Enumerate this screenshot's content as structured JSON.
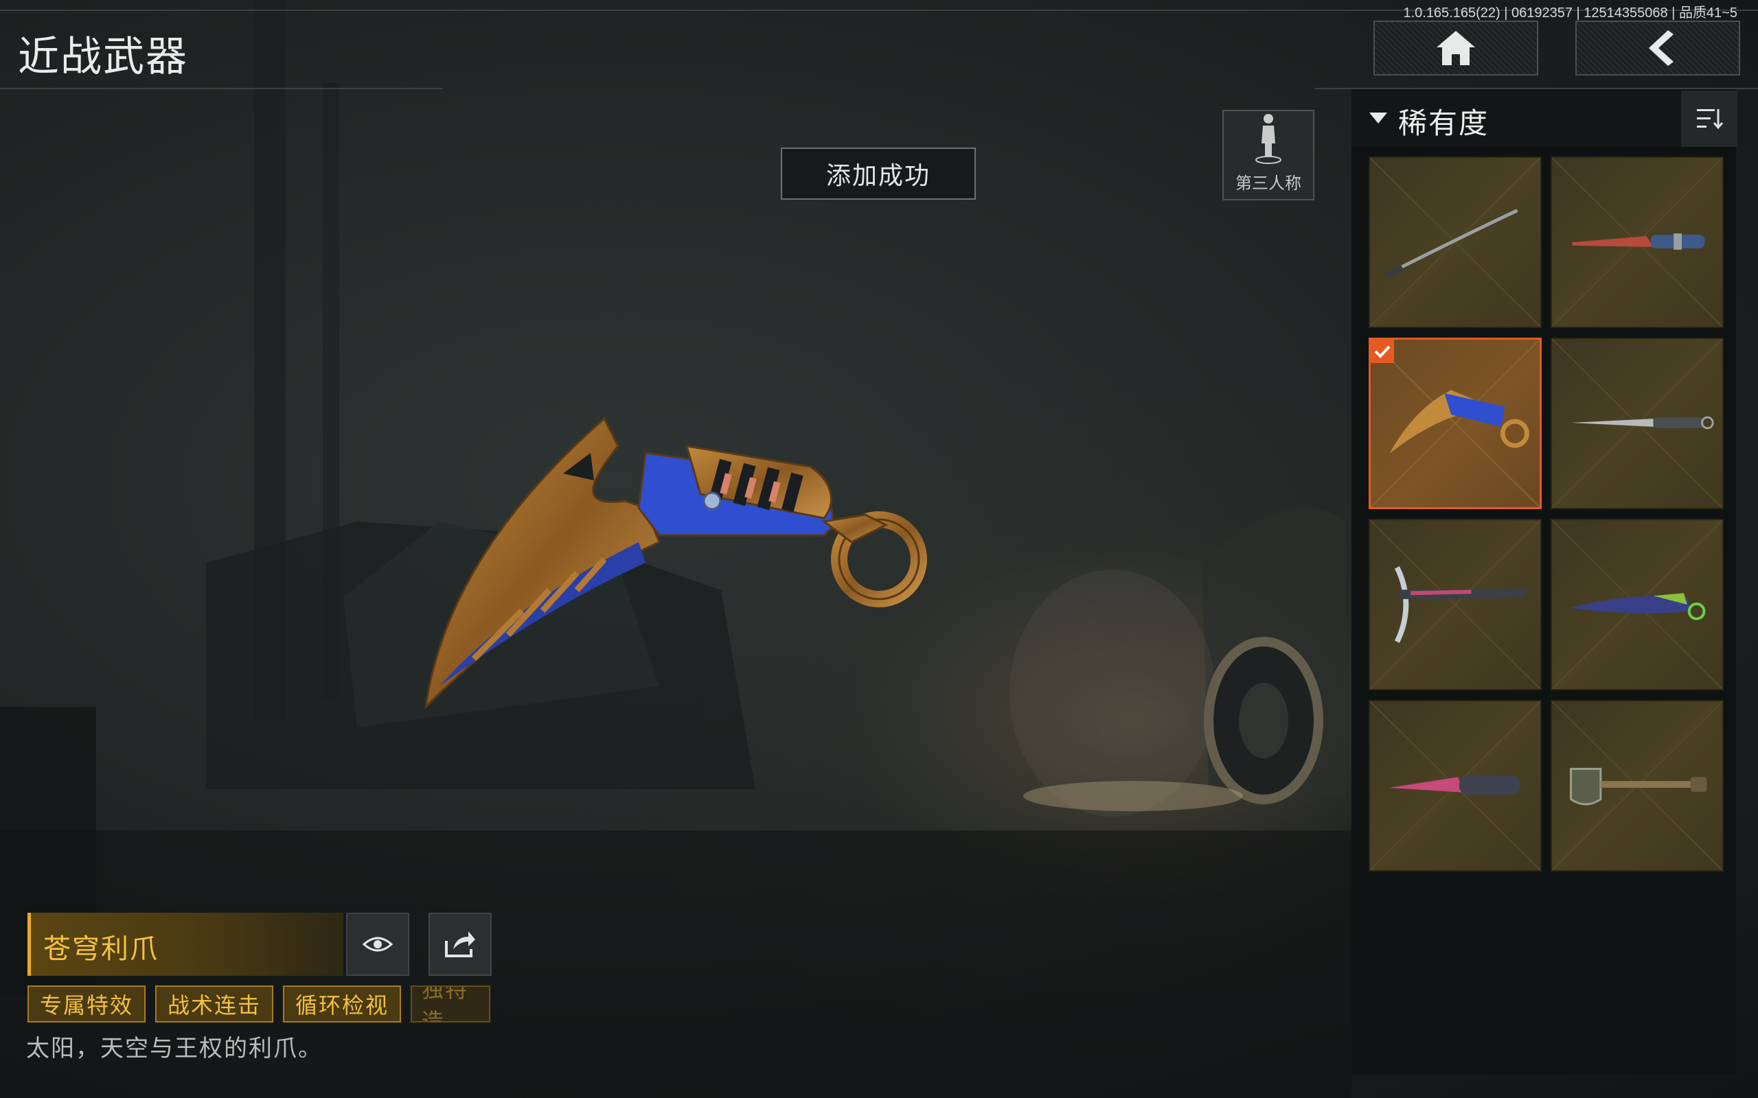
{
  "header": {
    "title": "近战武器",
    "version": "1.0.165.165(22) | 06192357 | 12514355068 | 品质41~5",
    "home_icon": "home-icon",
    "back_icon": "chevron-left-icon"
  },
  "toast": {
    "text": "添加成功"
  },
  "view_toggle": {
    "label": "第三人称",
    "icon": "person-icon"
  },
  "filter": {
    "label": "稀有度",
    "sort_icon": "sort-icon"
  },
  "inventory": {
    "items": [
      {
        "icon": "katana-icon",
        "selected": false
      },
      {
        "icon": "combat-knife-red-icon",
        "selected": false
      },
      {
        "icon": "karambit-gold-blue-icon",
        "selected": true
      },
      {
        "icon": "dagger-icon",
        "selected": false
      },
      {
        "icon": "pickaxe-icon",
        "selected": false
      },
      {
        "icon": "karambit-blue-icon",
        "selected": false
      },
      {
        "icon": "pink-knife-icon",
        "selected": false
      },
      {
        "icon": "shovel-icon",
        "selected": false
      }
    ]
  },
  "weapon": {
    "name": "苍穹利爪",
    "tags": [
      "专属特效",
      "战术连击",
      "循环检视",
      "独特造"
    ],
    "description": "太阳，天空与王权的利爪。"
  },
  "colors": {
    "accent": "#f0a818",
    "selected_border": "#e55a22",
    "tile_bg": "#4a4123"
  }
}
